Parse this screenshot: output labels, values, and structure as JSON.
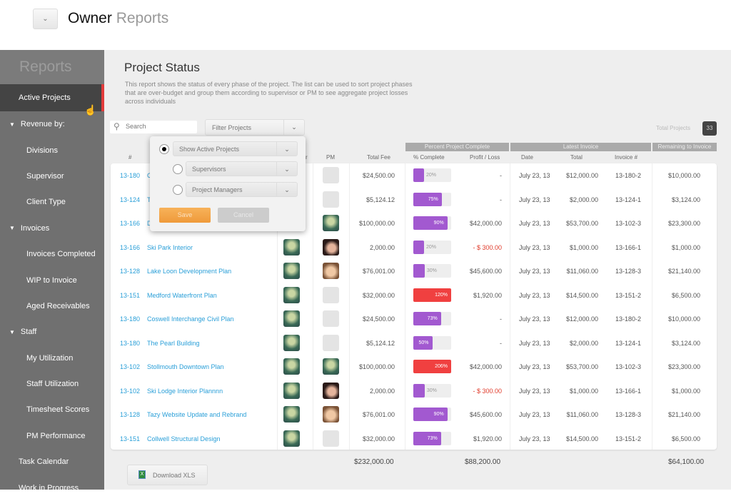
{
  "header": {
    "title_strong": "Owner",
    "title_light": "Reports",
    "menu_icon": "chevron-down-icon"
  },
  "sidebar": {
    "title": "Reports",
    "items": [
      {
        "label": "Active Projects",
        "level": "l1",
        "active": true
      },
      {
        "label": "Revenue by:",
        "level": "sec"
      },
      {
        "label": "Divisions",
        "level": "l2"
      },
      {
        "label": "Supervisor",
        "level": "l2"
      },
      {
        "label": "Client Type",
        "level": "l2"
      },
      {
        "label": "Invoices",
        "level": "sec"
      },
      {
        "label": "Invoices Completed",
        "level": "l2"
      },
      {
        "label": "WIP to Invoice",
        "level": "l2"
      },
      {
        "label": "Aged Receivables",
        "level": "l2"
      },
      {
        "label": "Staff",
        "level": "sec"
      },
      {
        "label": "My Utilization",
        "level": "l2"
      },
      {
        "label": "Staff Utilization",
        "level": "l2"
      },
      {
        "label": "Timesheet Scores",
        "level": "l2"
      },
      {
        "label": "PM Performance",
        "level": "l2"
      },
      {
        "label": "Task Calendar",
        "level": "l1"
      },
      {
        "label": "Work in Progress",
        "level": "l1"
      }
    ]
  },
  "main": {
    "title": "Project Status",
    "description": "This report shows  the status of every phase of the project. The list can be used to sort project phases that are over-budget and group them according to supervisor or PM to see aggregate project losses across individuals",
    "search_placeholder": "Search",
    "filter_label": "Filter Projects",
    "total_label": "Total Projects",
    "total_count": "33",
    "groups": {
      "percent": "Percent Project Complete",
      "invoice": "Latest Invoice",
      "remaining": "Remaining to Invoice"
    },
    "columns": {
      "num": "#",
      "supervisor": "r",
      "pm": "PM",
      "fee": "Total Fee",
      "complete": "% Complete",
      "profit": "Profit / Loss",
      "date": "Date",
      "total": "Total",
      "invoice": "Invoice #"
    },
    "colors": {
      "link": "#2a9fd8",
      "bar_ok": "#a259d0",
      "bar_over": "#f04040",
      "loss": "#e03a2a"
    },
    "rows": [
      {
        "num": "13-180",
        "name": "C",
        "sup": "",
        "pm": "blank",
        "fee": "$24,500.00",
        "pct": 20,
        "pl": "-",
        "date": "July 23, 13",
        "total": "$12,000.00",
        "inv": "13-180-2",
        "rem": "$10,000.00"
      },
      {
        "num": "13-124",
        "name": "T",
        "sup": "",
        "pm": "blank",
        "fee": "$5,124.12",
        "pct": 75,
        "pl": "-",
        "date": "July 23, 13",
        "total": "$2,000.00",
        "inv": "13-124-1",
        "rem": "$3,124.00"
      },
      {
        "num": "13-166",
        "name": "D",
        "sup": "",
        "pm": "green",
        "fee": "$100,000.00",
        "pct": 90,
        "pl": "$42,000.00",
        "date": "July 23, 13",
        "total": "$53,700.00",
        "inv": "13-102-3",
        "rem": "$23,300.00"
      },
      {
        "num": "13-166",
        "name": "Ski Park Interior",
        "sup": "green",
        "pm": "w1",
        "fee": "2,000.00",
        "pct": 20,
        "pl": "- $ 300.00",
        "loss": true,
        "date": "July 23, 13",
        "total": "$1,000.00",
        "inv": "13-166-1",
        "rem": "$1,000.00"
      },
      {
        "num": "13-128",
        "name": "Lake Loon Development Plan",
        "sup": "green",
        "pm": "w2",
        "fee": "$76,001.00",
        "pct": 30,
        "pl": "$45,600.00",
        "date": "July 23, 13",
        "total": "$11,060.00",
        "inv": "13-128-3",
        "rem": "$21,140.00"
      },
      {
        "num": "13-151",
        "name": "Medford Waterfront Plan",
        "sup": "green",
        "pm": "blank",
        "fee": "$32,000.00",
        "pct": 120,
        "pl": "$1,920.00",
        "date": "July 23, 13",
        "total": "$14,500.00",
        "inv": "13-151-2",
        "rem": "$6,500.00"
      },
      {
        "num": "13-180",
        "name": "Coswell Interchange Civil Plan",
        "sup": "green",
        "pm": "blank",
        "fee": "$24,500.00",
        "pct": 73,
        "pl": "-",
        "date": "July 23, 13",
        "total": "$12,000.00",
        "inv": "13-180-2",
        "rem": "$10,000.00"
      },
      {
        "num": "13-180",
        "name": "The Pearl Building",
        "sup": "green",
        "pm": "blank",
        "fee": "$5,124.12",
        "pct": 50,
        "pl": "-",
        "date": "July 23, 13",
        "total": "$2,000.00",
        "inv": "13-124-1",
        "rem": "$3,124.00"
      },
      {
        "num": "13-102",
        "name": "Stollmouth Downtown Plan",
        "sup": "green",
        "pm": "green",
        "fee": "$100,000.00",
        "pct": 206,
        "pl": "$42,000.00",
        "date": "July 23, 13",
        "total": "$53,700.00",
        "inv": "13-102-3",
        "rem": "$23,300.00"
      },
      {
        "num": "13-102",
        "name": "Ski Lodge Interior Plannnn",
        "sup": "green",
        "pm": "w1",
        "fee": "2,000.00",
        "pct": 30,
        "pl": "- $ 300.00",
        "loss": true,
        "date": "July 23, 13",
        "total": "$1,000.00",
        "inv": "13-166-1",
        "rem": "$1,000.00"
      },
      {
        "num": "13-128",
        "name": "Tazy Website Update and Rebrand",
        "sup": "green",
        "pm": "w2",
        "fee": "$76,001.00",
        "pct": 90,
        "pl": "$45,600.00",
        "date": "July 23, 13",
        "total": "$11,060.00",
        "inv": "13-128-3",
        "rem": "$21,140.00"
      },
      {
        "num": "13-151",
        "name": "Collwell Structural Design",
        "sup": "green",
        "pm": "blank",
        "fee": "$32,000.00",
        "pct": 73,
        "pl": "$1,920.00",
        "date": "July 23, 13",
        "total": "$14,500.00",
        "inv": "13-151-2",
        "rem": "$6,500.00"
      }
    ],
    "totals": {
      "fee": "$232,000.00",
      "profit": "$88,200.00",
      "remaining": "$64,100.00"
    },
    "download_label": "Download XLS",
    "xls_icon": "X"
  },
  "popup": {
    "options": [
      {
        "label": "Show Active Projects",
        "selected": true
      },
      {
        "label": "Supervisors",
        "selected": false
      },
      {
        "label": "Project Managers",
        "selected": false
      }
    ],
    "save": "Save",
    "cancel": "Cancel"
  }
}
